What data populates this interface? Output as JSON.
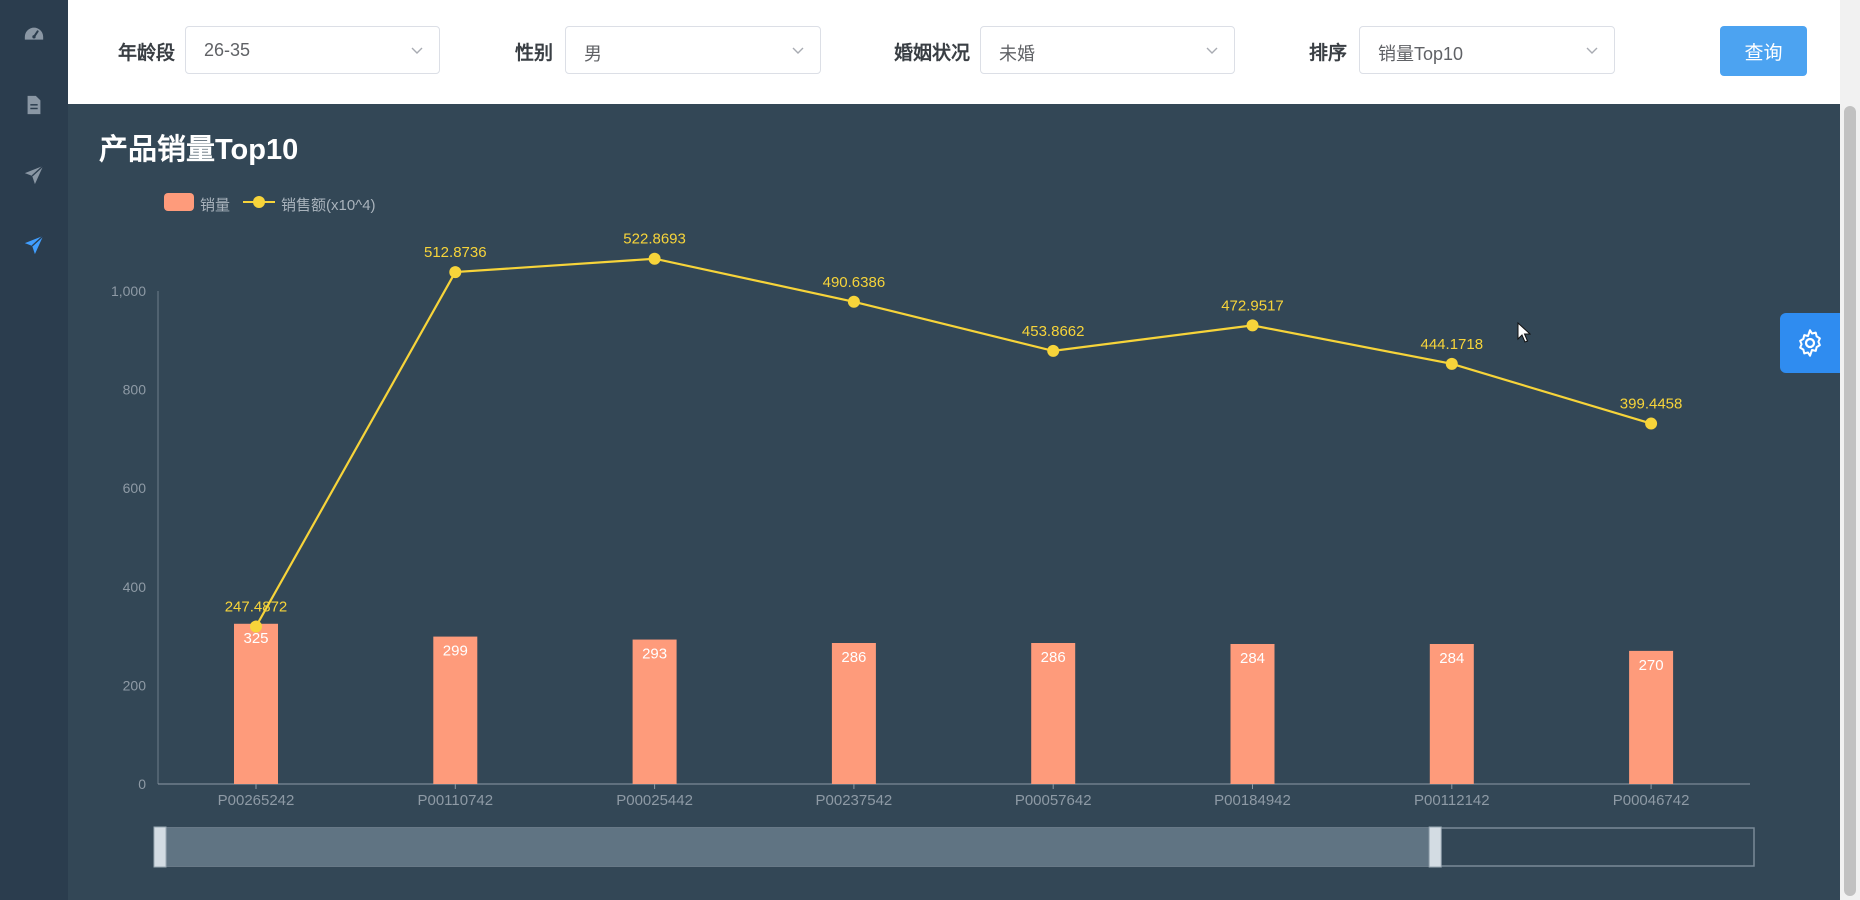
{
  "filters": {
    "age": {
      "label": "年龄段",
      "value": "26-35"
    },
    "gender": {
      "label": "性别",
      "value": "男"
    },
    "marital": {
      "label": "婚姻状况",
      "value": "未婚"
    },
    "sort": {
      "label": "排序",
      "value": "销量Top10"
    },
    "query_label": "查询"
  },
  "sidebar": {
    "items": [
      {
        "icon": "dashboard-icon"
      },
      {
        "icon": "document-icon"
      },
      {
        "icon": "paper-plane-icon"
      },
      {
        "icon": "paper-plane-icon",
        "active": true
      }
    ]
  },
  "colors": {
    "bar": "#fe9b7b",
    "line": "#f7d43a",
    "background": "#334756",
    "accent": "#4ca3f1"
  },
  "chart_data": {
    "type": "bar",
    "title": "产品销量Top10",
    "categories": [
      "P00265242",
      "P00110742",
      "P00025442",
      "P00237542",
      "P00057642",
      "P00184942",
      "P00112142",
      "P00046742"
    ],
    "series": [
      {
        "name": "销量",
        "type": "bar",
        "values": [
          325,
          299,
          293,
          286,
          286,
          284,
          284,
          270
        ]
      },
      {
        "name": "销售额(x10^4)",
        "type": "line",
        "values": [
          247.4872,
          512.8736,
          522.8693,
          490.6386,
          453.8662,
          472.9517,
          444.1718,
          399.4458
        ]
      }
    ],
    "y_ticks": [
      "0",
      "200",
      "400",
      "600",
      "800",
      "1,000"
    ],
    "ylim": [
      0,
      1000
    ],
    "legend_position": "top-left",
    "grid": false,
    "datazoom": {
      "start_fraction": 0,
      "end_fraction": 0.8
    }
  }
}
